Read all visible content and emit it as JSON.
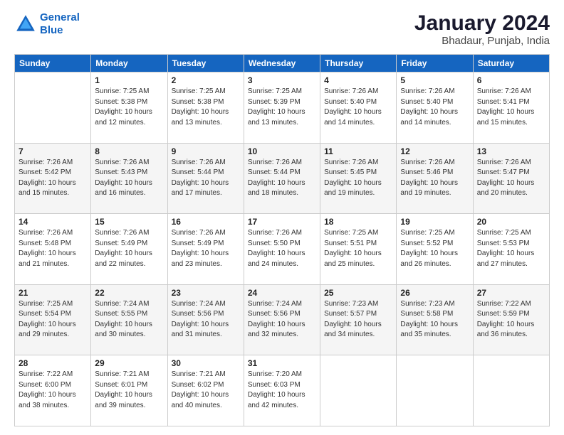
{
  "logo": {
    "line1": "General",
    "line2": "Blue"
  },
  "title": "January 2024",
  "subtitle": "Bhadaur, Punjab, India",
  "headers": [
    "Sunday",
    "Monday",
    "Tuesday",
    "Wednesday",
    "Thursday",
    "Friday",
    "Saturday"
  ],
  "weeks": [
    [
      {
        "day": "",
        "sunrise": "",
        "sunset": "",
        "daylight": ""
      },
      {
        "day": "1",
        "sunrise": "Sunrise: 7:25 AM",
        "sunset": "Sunset: 5:38 PM",
        "daylight": "Daylight: 10 hours and 12 minutes."
      },
      {
        "day": "2",
        "sunrise": "Sunrise: 7:25 AM",
        "sunset": "Sunset: 5:38 PM",
        "daylight": "Daylight: 10 hours and 13 minutes."
      },
      {
        "day": "3",
        "sunrise": "Sunrise: 7:25 AM",
        "sunset": "Sunset: 5:39 PM",
        "daylight": "Daylight: 10 hours and 13 minutes."
      },
      {
        "day": "4",
        "sunrise": "Sunrise: 7:26 AM",
        "sunset": "Sunset: 5:40 PM",
        "daylight": "Daylight: 10 hours and 14 minutes."
      },
      {
        "day": "5",
        "sunrise": "Sunrise: 7:26 AM",
        "sunset": "Sunset: 5:40 PM",
        "daylight": "Daylight: 10 hours and 14 minutes."
      },
      {
        "day": "6",
        "sunrise": "Sunrise: 7:26 AM",
        "sunset": "Sunset: 5:41 PM",
        "daylight": "Daylight: 10 hours and 15 minutes."
      }
    ],
    [
      {
        "day": "7",
        "sunrise": "Sunrise: 7:26 AM",
        "sunset": "Sunset: 5:42 PM",
        "daylight": "Daylight: 10 hours and 15 minutes."
      },
      {
        "day": "8",
        "sunrise": "Sunrise: 7:26 AM",
        "sunset": "Sunset: 5:43 PM",
        "daylight": "Daylight: 10 hours and 16 minutes."
      },
      {
        "day": "9",
        "sunrise": "Sunrise: 7:26 AM",
        "sunset": "Sunset: 5:44 PM",
        "daylight": "Daylight: 10 hours and 17 minutes."
      },
      {
        "day": "10",
        "sunrise": "Sunrise: 7:26 AM",
        "sunset": "Sunset: 5:44 PM",
        "daylight": "Daylight: 10 hours and 18 minutes."
      },
      {
        "day": "11",
        "sunrise": "Sunrise: 7:26 AM",
        "sunset": "Sunset: 5:45 PM",
        "daylight": "Daylight: 10 hours and 19 minutes."
      },
      {
        "day": "12",
        "sunrise": "Sunrise: 7:26 AM",
        "sunset": "Sunset: 5:46 PM",
        "daylight": "Daylight: 10 hours and 19 minutes."
      },
      {
        "day": "13",
        "sunrise": "Sunrise: 7:26 AM",
        "sunset": "Sunset: 5:47 PM",
        "daylight": "Daylight: 10 hours and 20 minutes."
      }
    ],
    [
      {
        "day": "14",
        "sunrise": "Sunrise: 7:26 AM",
        "sunset": "Sunset: 5:48 PM",
        "daylight": "Daylight: 10 hours and 21 minutes."
      },
      {
        "day": "15",
        "sunrise": "Sunrise: 7:26 AM",
        "sunset": "Sunset: 5:49 PM",
        "daylight": "Daylight: 10 hours and 22 minutes."
      },
      {
        "day": "16",
        "sunrise": "Sunrise: 7:26 AM",
        "sunset": "Sunset: 5:49 PM",
        "daylight": "Daylight: 10 hours and 23 minutes."
      },
      {
        "day": "17",
        "sunrise": "Sunrise: 7:26 AM",
        "sunset": "Sunset: 5:50 PM",
        "daylight": "Daylight: 10 hours and 24 minutes."
      },
      {
        "day": "18",
        "sunrise": "Sunrise: 7:25 AM",
        "sunset": "Sunset: 5:51 PM",
        "daylight": "Daylight: 10 hours and 25 minutes."
      },
      {
        "day": "19",
        "sunrise": "Sunrise: 7:25 AM",
        "sunset": "Sunset: 5:52 PM",
        "daylight": "Daylight: 10 hours and 26 minutes."
      },
      {
        "day": "20",
        "sunrise": "Sunrise: 7:25 AM",
        "sunset": "Sunset: 5:53 PM",
        "daylight": "Daylight: 10 hours and 27 minutes."
      }
    ],
    [
      {
        "day": "21",
        "sunrise": "Sunrise: 7:25 AM",
        "sunset": "Sunset: 5:54 PM",
        "daylight": "Daylight: 10 hours and 29 minutes."
      },
      {
        "day": "22",
        "sunrise": "Sunrise: 7:24 AM",
        "sunset": "Sunset: 5:55 PM",
        "daylight": "Daylight: 10 hours and 30 minutes."
      },
      {
        "day": "23",
        "sunrise": "Sunrise: 7:24 AM",
        "sunset": "Sunset: 5:56 PM",
        "daylight": "Daylight: 10 hours and 31 minutes."
      },
      {
        "day": "24",
        "sunrise": "Sunrise: 7:24 AM",
        "sunset": "Sunset: 5:56 PM",
        "daylight": "Daylight: 10 hours and 32 minutes."
      },
      {
        "day": "25",
        "sunrise": "Sunrise: 7:23 AM",
        "sunset": "Sunset: 5:57 PM",
        "daylight": "Daylight: 10 hours and 34 minutes."
      },
      {
        "day": "26",
        "sunrise": "Sunrise: 7:23 AM",
        "sunset": "Sunset: 5:58 PM",
        "daylight": "Daylight: 10 hours and 35 minutes."
      },
      {
        "day": "27",
        "sunrise": "Sunrise: 7:22 AM",
        "sunset": "Sunset: 5:59 PM",
        "daylight": "Daylight: 10 hours and 36 minutes."
      }
    ],
    [
      {
        "day": "28",
        "sunrise": "Sunrise: 7:22 AM",
        "sunset": "Sunset: 6:00 PM",
        "daylight": "Daylight: 10 hours and 38 minutes."
      },
      {
        "day": "29",
        "sunrise": "Sunrise: 7:21 AM",
        "sunset": "Sunset: 6:01 PM",
        "daylight": "Daylight: 10 hours and 39 minutes."
      },
      {
        "day": "30",
        "sunrise": "Sunrise: 7:21 AM",
        "sunset": "Sunset: 6:02 PM",
        "daylight": "Daylight: 10 hours and 40 minutes."
      },
      {
        "day": "31",
        "sunrise": "Sunrise: 7:20 AM",
        "sunset": "Sunset: 6:03 PM",
        "daylight": "Daylight: 10 hours and 42 minutes."
      },
      {
        "day": "",
        "sunrise": "",
        "sunset": "",
        "daylight": ""
      },
      {
        "day": "",
        "sunrise": "",
        "sunset": "",
        "daylight": ""
      },
      {
        "day": "",
        "sunrise": "",
        "sunset": "",
        "daylight": ""
      }
    ]
  ]
}
